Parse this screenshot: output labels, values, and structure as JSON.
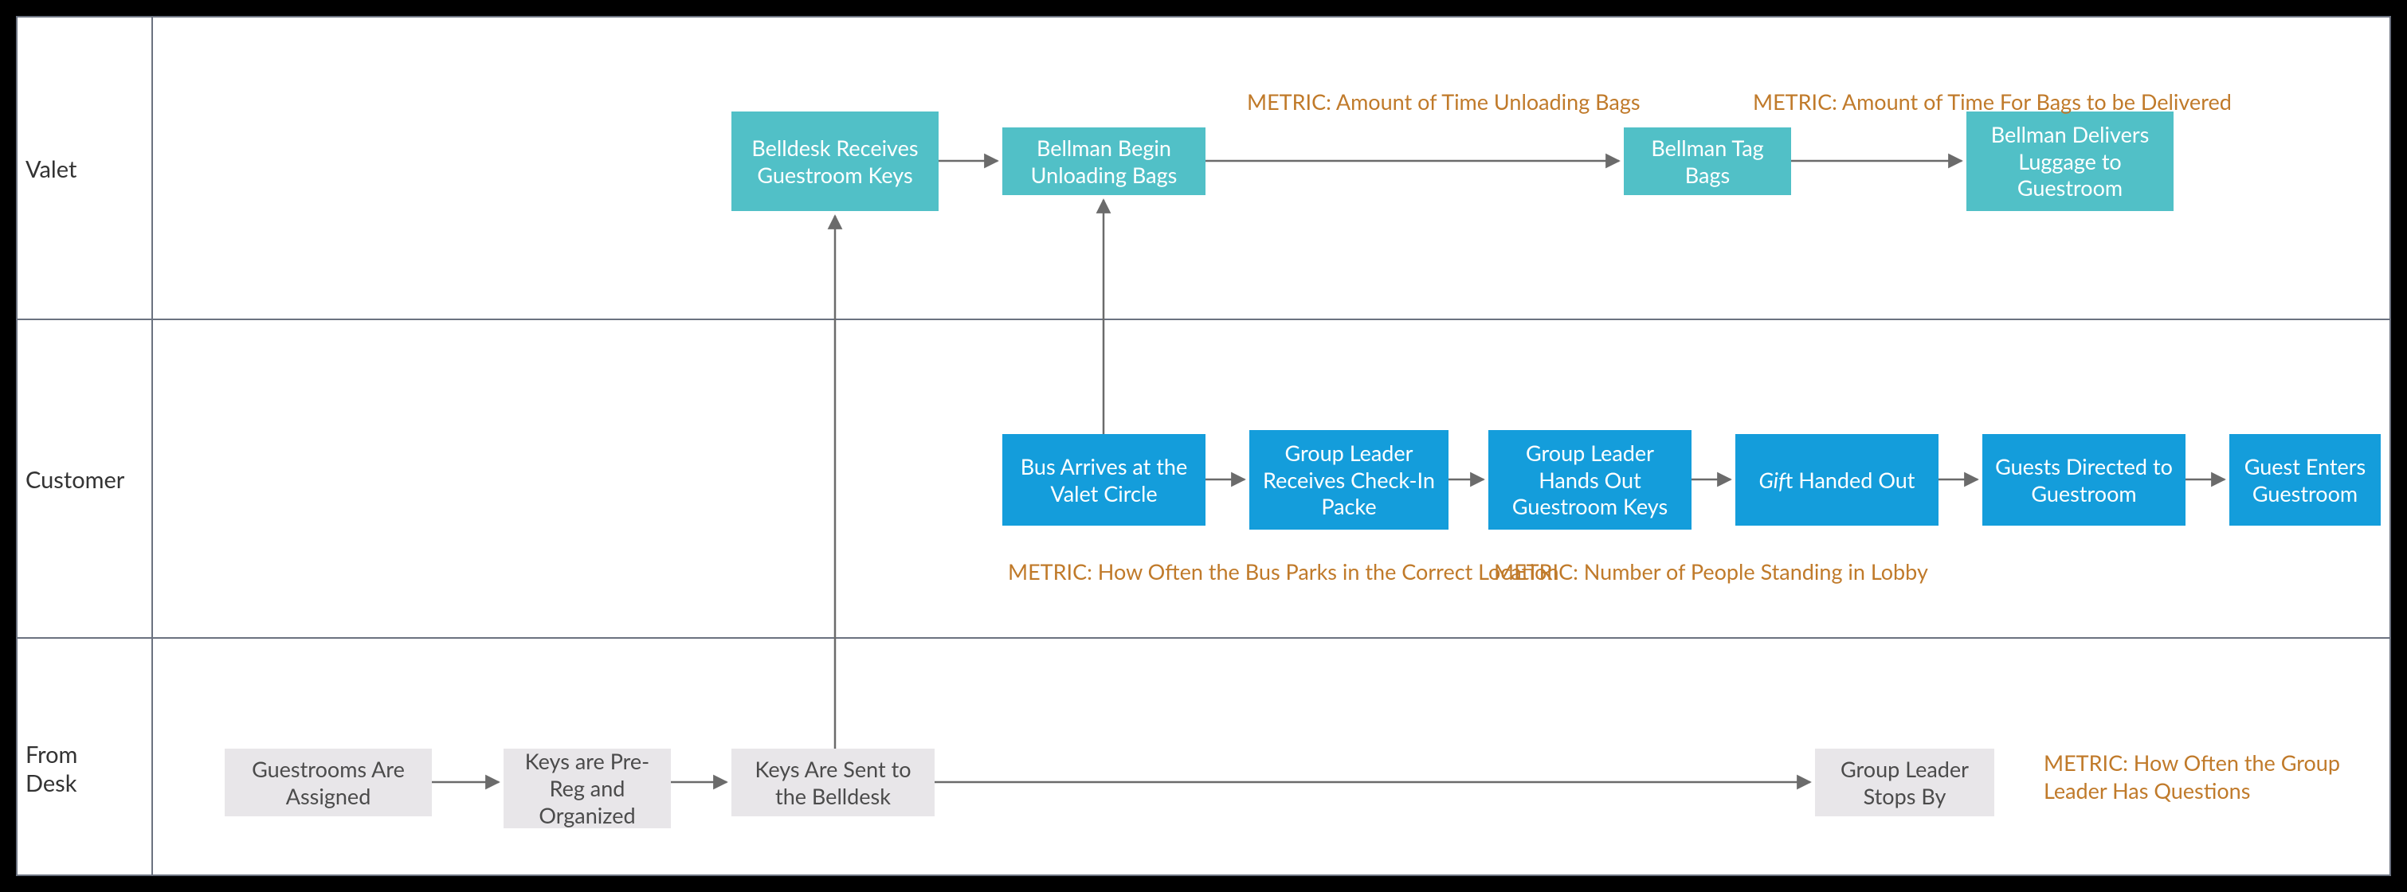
{
  "lanes": {
    "valet": "Valet",
    "customer": "Customer",
    "fromdesk": "From\nDesk"
  },
  "nodes": {
    "belldesk_receives": "Belldesk\nReceives\nGuestroom Keys",
    "bellman_begin": "Bellman Begin\nUnloading Bags",
    "bellman_tag": "Bellman Tag\nBags",
    "bellman_delivers": "Bellman Delivers\nLuggage to\nGuestroom",
    "bus_arrives": "Bus Arrives at\nthe Valet Circle",
    "leader_receives": "Group Leader\nReceives\nCheck-In Packe",
    "leader_hands": "Group Leader\nHands Out\nGuestroom Keys",
    "gift": "Gift Handed Out",
    "guests_directed": "Guests Directed\nto Guestroom",
    "guest_enters": "Guest Enters\nGuestroom",
    "guestrooms_assigned": "Guestrooms Are\nAssigned",
    "keys_prereg": "Keys are\nPre-Reg and\nOrganized",
    "keys_sent": "Keys Are Sent to\nthe Belldesk",
    "leader_stops": "Group Leader\nStops By"
  },
  "metrics": {
    "time_unloading": "METRIC: Amount of Time\nUnloading Bags",
    "time_delivered": "METRIC: Amount of Time For\nBags to be Delivered",
    "bus_parks": "METRIC: How Often the Bus\nParks in the Correct Location",
    "people_lobby": "METRIC: Number of People\nStanding in Lobby",
    "leader_questions": "METRIC: How Often the\nGroup Leader Has Questions"
  }
}
